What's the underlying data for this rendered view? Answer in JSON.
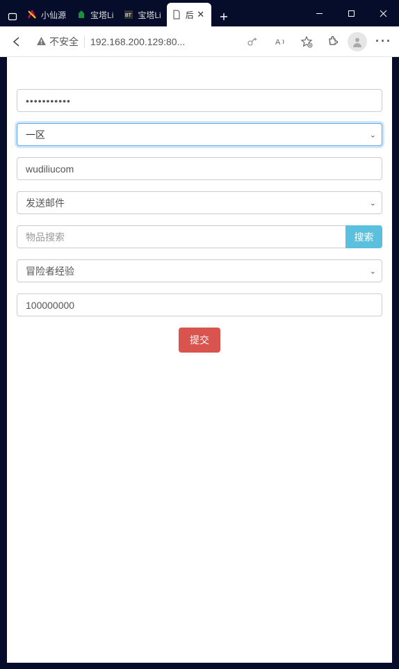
{
  "window": {
    "tabs": [
      {
        "label": "小仙源"
      },
      {
        "label": "宝塔Li"
      },
      {
        "label": "宝塔Li"
      },
      {
        "label": "后"
      }
    ],
    "active_tab_index": 3
  },
  "addressbar": {
    "insecure_label": "不安全",
    "url": "192.168.200.129:80..."
  },
  "form": {
    "password_value": "•••••••••••",
    "zone_value": "一区",
    "user_value": "wudiliucom",
    "action_value": "发送邮件",
    "item_search_placeholder": "物品搜索",
    "item_search_value": "",
    "search_btn": "搜索",
    "attr_value": "冒险者经验",
    "qty_value": "100000000",
    "submit": "提交"
  }
}
